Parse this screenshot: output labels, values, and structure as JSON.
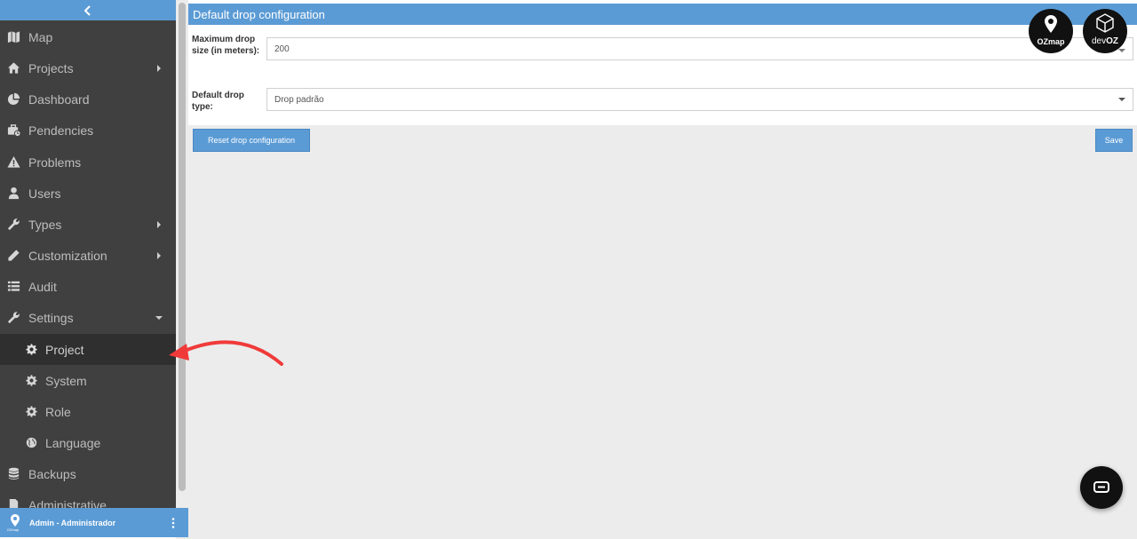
{
  "sidebar": {
    "items": [
      {
        "label": "Map",
        "icon": "map-icon"
      },
      {
        "label": "Projects",
        "icon": "home-icon"
      },
      {
        "label": "Dashboard",
        "icon": "pie-chart-icon"
      },
      {
        "label": "Pendencies",
        "icon": "briefcase-clock-icon"
      },
      {
        "label": "Problems",
        "icon": "warning-icon"
      },
      {
        "label": "Users",
        "icon": "user-icon"
      },
      {
        "label": "Types",
        "icon": "wrench-icon"
      },
      {
        "label": "Customization",
        "icon": "pencil-icon"
      },
      {
        "label": "Audit",
        "icon": "list-icon"
      },
      {
        "label": "Settings",
        "icon": "wrench-icon"
      }
    ],
    "settings_sub": [
      {
        "label": "Project",
        "icon": "gear-icon"
      },
      {
        "label": "System",
        "icon": "gear-icon"
      },
      {
        "label": "Role",
        "icon": "gear-icon"
      },
      {
        "label": "Language",
        "icon": "globe-icon"
      }
    ],
    "more_items": [
      {
        "label": "Backups",
        "icon": "database-icon"
      },
      {
        "label": "Administrative",
        "icon": "document-icon"
      }
    ]
  },
  "user": {
    "name": "Admin - Administrador",
    "logo_text": "OZmap"
  },
  "panel": {
    "title": "Default drop configuration",
    "max_size_label": "Maximum drop size (in meters):",
    "max_size_value": "200",
    "drop_type_label": "Default drop type:",
    "drop_type_value": "Drop padrão",
    "reset_label": "Reset drop configuration",
    "save_label": "Save"
  },
  "badges": {
    "ozmap": "OZmap",
    "devoz_prefix": "dev",
    "devoz_suffix": "OZ"
  },
  "colors": {
    "accent": "#5b9bd5",
    "sidebar": "#404040",
    "annotation": "#f03a3a"
  }
}
